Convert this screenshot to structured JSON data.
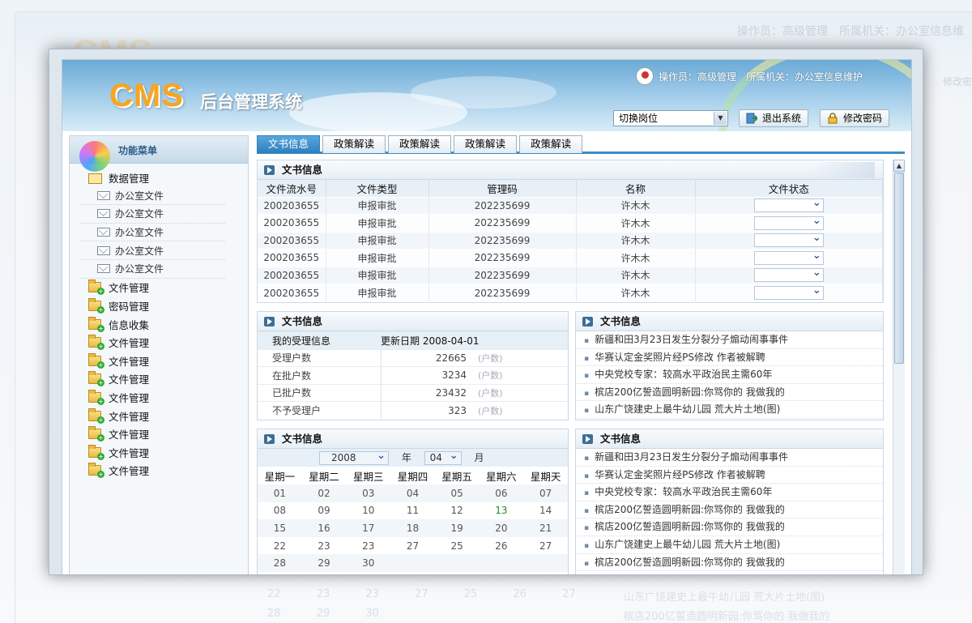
{
  "background": {
    "operator_text": "操作员：高级管理　所属机关：办公室信息维",
    "modify_text": "修改密",
    "ghost_calendar_row": [
      "22",
      "23",
      "23",
      "27",
      "25",
      "26",
      "27"
    ],
    "ghost_calendar_row2": [
      "28",
      "29",
      "30"
    ],
    "ghost_news": [
      "山东广饶建史上最牛幼儿园 荒大片土地(图)",
      "槟店200亿誓造圆明新园:你骂你的 我做我的"
    ]
  },
  "header": {
    "logo": "CMS",
    "system_title": "后台管理系统",
    "operator": "操作员：高级管理",
    "agency": "所属机关：办公室信息维护",
    "role_select": "切换岗位",
    "logout_label": "退出系统",
    "change_password_label": "修改密码"
  },
  "sidebar": {
    "title": "功能菜单",
    "group": {
      "label": "数据管理",
      "children": [
        "办公室文件",
        "办公室文件",
        "办公室文件",
        "办公室文件",
        "办公室文件"
      ]
    },
    "items": [
      "文件管理",
      "密码管理",
      "信息收集",
      "文件管理",
      "文件管理",
      "文件管理",
      "文件管理",
      "文件管理",
      "文件管理",
      "文件管理",
      "文件管理"
    ]
  },
  "tabs": [
    "文书信息",
    "政策解读",
    "政策解读",
    "政策解读",
    "政策解读"
  ],
  "panel_top": {
    "title": "文书信息",
    "columns": [
      "文件流水号",
      "文件类型",
      "管理码",
      "名称",
      "文件状态"
    ],
    "rows": [
      [
        "200203655",
        "申报审批",
        "202235699",
        "许木木"
      ],
      [
        "200203655",
        "申报审批",
        "202235699",
        "许木木"
      ],
      [
        "200203655",
        "申报审批",
        "202235699",
        "许木木"
      ],
      [
        "200203655",
        "申报审批",
        "202235699",
        "许木木"
      ],
      [
        "200203655",
        "申报审批",
        "202235699",
        "许木木"
      ],
      [
        "200203655",
        "申报审批",
        "202235699",
        "许木木"
      ]
    ]
  },
  "panel_stats": {
    "title": "文书信息",
    "head_label": "我的受理信息",
    "head_date": "更新日期  2008-04-01",
    "rows": [
      {
        "label": "受理户数",
        "value": "22665",
        "unit": "(户数)"
      },
      {
        "label": "在批户数",
        "value": "3234",
        "unit": "(户数)"
      },
      {
        "label": "已批户数",
        "value": "23432",
        "unit": "(户数)"
      },
      {
        "label": "不予受理户",
        "value": "323",
        "unit": "(户数)"
      }
    ]
  },
  "panel_news1": {
    "title": "文书信息",
    "items": [
      "新疆和田3月23日发生分裂分子煽动闹事事件",
      "华赛认定金奖照片经PS修改 作者被解聘",
      "中央党校专家：较高水平政治民主需60年",
      "槟店200亿誓造圆明新园:你骂你的 我做我的",
      "山东广饶建史上最牛幼儿园 荒大片土地(图)"
    ]
  },
  "panel_calendar": {
    "title": "文书信息",
    "year": "2008",
    "year_label": "年",
    "month": "04",
    "month_label": "月",
    "weekdays": [
      "星期一",
      "星期二",
      "星期三",
      "星期四",
      "星期五",
      "星期六",
      "星期天"
    ],
    "weeks": [
      [
        "01",
        "02",
        "03",
        "04",
        "05",
        "06",
        "07"
      ],
      [
        "08",
        "09",
        "10",
        "11",
        "12",
        "13",
        "14"
      ],
      [
        "15",
        "16",
        "17",
        "18",
        "19",
        "20",
        "21"
      ],
      [
        "22",
        "23",
        "23",
        "27",
        "25",
        "26",
        "27"
      ],
      [
        "28",
        "29",
        "30",
        "",
        "",
        "",
        ""
      ]
    ],
    "highlight_color": "#1e8a1e"
  },
  "panel_news2": {
    "title": "文书信息",
    "items": [
      "新疆和田3月23日发生分裂分子煽动闹事事件",
      "华赛认定金奖照片经PS修改 作者被解聘",
      "中央党校专家：较高水平政治民主需60年",
      "槟店200亿誓造圆明新园:你骂你的 我做我的",
      "槟店200亿誓造圆明新园:你骂你的 我做我的",
      "山东广饶建史上最牛幼儿园 荒大片土地(图)",
      "槟店200亿誓造圆明新园:你骂你的 我做我的"
    ]
  },
  "colors": {
    "accent": "#2d7fbd",
    "logo": "#f5a623"
  }
}
